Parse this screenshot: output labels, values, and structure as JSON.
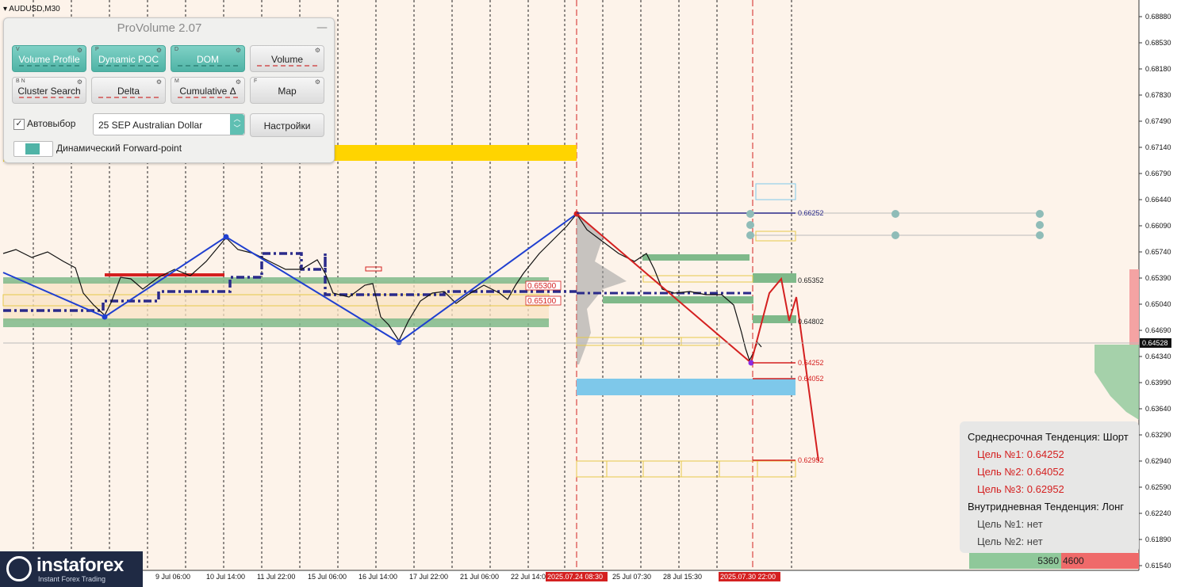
{
  "chart_title": "AUDUSD,M30",
  "price_axis": [
    "0.68880",
    "0.68530",
    "0.68180",
    "0.67830",
    "0.67490",
    "0.67140",
    "0.66790",
    "0.66440",
    "0.66090",
    "0.65740",
    "0.65390",
    "0.65040",
    "0.64690",
    "0.64528",
    "0.64340",
    "0.63990",
    "0.63640",
    "0.63290",
    "0.62940",
    "0.62590",
    "0.62240",
    "0.61890",
    "0.61540"
  ],
  "current_price": "0.64528",
  "time_axis": [
    "9 Jul 06:00",
    "10 Jul 14:00",
    "11 Jul 22:00",
    "15 Jul 06:00",
    "16 Jul 14:00",
    "17 Jul 22:00",
    "21 Jul 06:00",
    "22 Jul 14:00",
    "2025.07.24 08:30",
    "25 Jul 07:30",
    "28 Jul 15:30",
    "2025.07.30 22:00"
  ],
  "level_labels": {
    "l66252": "0.66252",
    "l65352": "0.65352",
    "l65300": "0.65300",
    "l65100": "0.65100",
    "l64802": "0.64802",
    "l64252": "0.64252",
    "l64052": "0.64052",
    "l62952": "0.62952"
  },
  "panel": {
    "title": "ProVolume 2.07",
    "minimize": "—",
    "buttons": [
      {
        "label": "Volume Profile",
        "hotkey": "V",
        "on": true
      },
      {
        "label": "Dynamic POC",
        "hotkey": "P",
        "on": true
      },
      {
        "label": "DOM",
        "hotkey": "D",
        "on": true
      },
      {
        "label": "Volume",
        "hotkey": "",
        "on": false
      },
      {
        "label": "Cluster Search",
        "hotkey": "B N",
        "on": false
      },
      {
        "label": "Delta",
        "hotkey": "",
        "on": false
      },
      {
        "label": "Cumulative Δ",
        "hotkey": "M",
        "on": false
      },
      {
        "label": "Map",
        "hotkey": "F",
        "on": false
      }
    ],
    "auto_select_label": "Автовыбор",
    "instrument": "25 SEP Australian Dollar",
    "settings_button": "Настройки",
    "forward_point_label": "Динамический Forward-point"
  },
  "info": {
    "mid_trend": "Среднесрочная Тенденция: Шорт",
    "target1": "Цель №1: 0.64252",
    "target2": "Цель №2: 0.64052",
    "target3": "Цель №3: 0.62952",
    "intraday_trend": "Внутридневная Тенденция: Лонг",
    "intraday_t1": "Цель №1: нет",
    "intraday_t2": "Цель №2: нет"
  },
  "volume_bar": {
    "buy": "5360",
    "sell": "4600"
  },
  "logo": {
    "name": "instaforex",
    "tagline": "Instant Forex Trading"
  },
  "colors": {
    "bg": "#fdf3ea",
    "blue_zigzag": "#1f3fd0",
    "red_zigzag": "#d42020",
    "navy_dash": "#2a2a8a",
    "green_band": "#7fb98a",
    "yellow_band": "#ffd400",
    "cyan_zone": "#7ec8ea"
  }
}
